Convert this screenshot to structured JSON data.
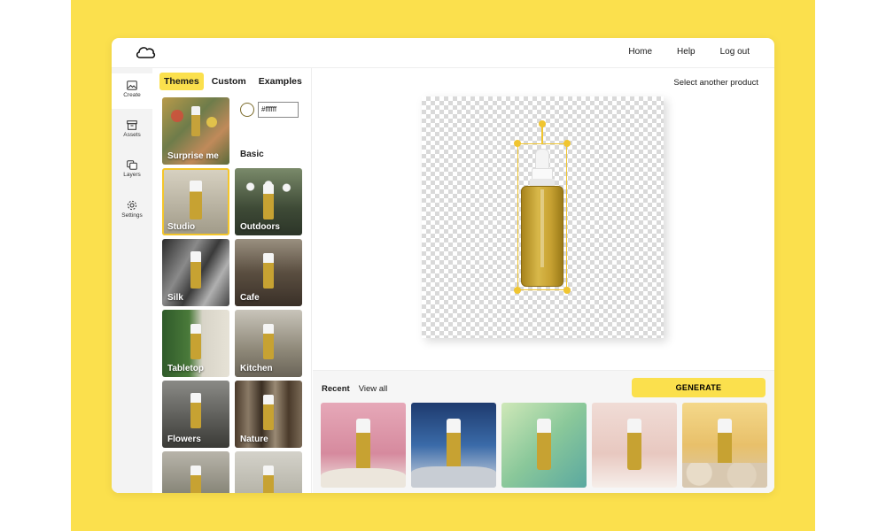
{
  "header": {
    "nav": [
      "Home",
      "Help",
      "Log out"
    ]
  },
  "rail": {
    "items": [
      {
        "label": "Create",
        "icon": "image-icon",
        "active": true
      },
      {
        "label": "Assets",
        "icon": "archive-icon",
        "active": false
      },
      {
        "label": "Layers",
        "icon": "layers-icon",
        "active": false
      },
      {
        "label": "Settings",
        "icon": "gear-icon",
        "active": false
      }
    ]
  },
  "panel": {
    "tabs": [
      "Themes",
      "Custom",
      "Examples"
    ],
    "active_tab": "Themes",
    "basic_color_value": "#ffffff",
    "themes": [
      {
        "label": "Surprise me"
      },
      {
        "label": "Basic"
      },
      {
        "label": "Studio",
        "selected": true
      },
      {
        "label": "Outdoors"
      },
      {
        "label": "Silk"
      },
      {
        "label": "Cafe"
      },
      {
        "label": "Tabletop"
      },
      {
        "label": "Kitchen"
      },
      {
        "label": "Flowers"
      },
      {
        "label": "Nature"
      },
      {
        "label": ""
      },
      {
        "label": ""
      }
    ]
  },
  "main": {
    "select_product": "Select another product",
    "zoom_level": 0.35
  },
  "bottom": {
    "recent_label": "Recent",
    "view_all_label": "View all",
    "generate_label": "GENERATE"
  },
  "colors": {
    "brand_yellow": "#fbe04d",
    "accent": "#f0c530"
  }
}
